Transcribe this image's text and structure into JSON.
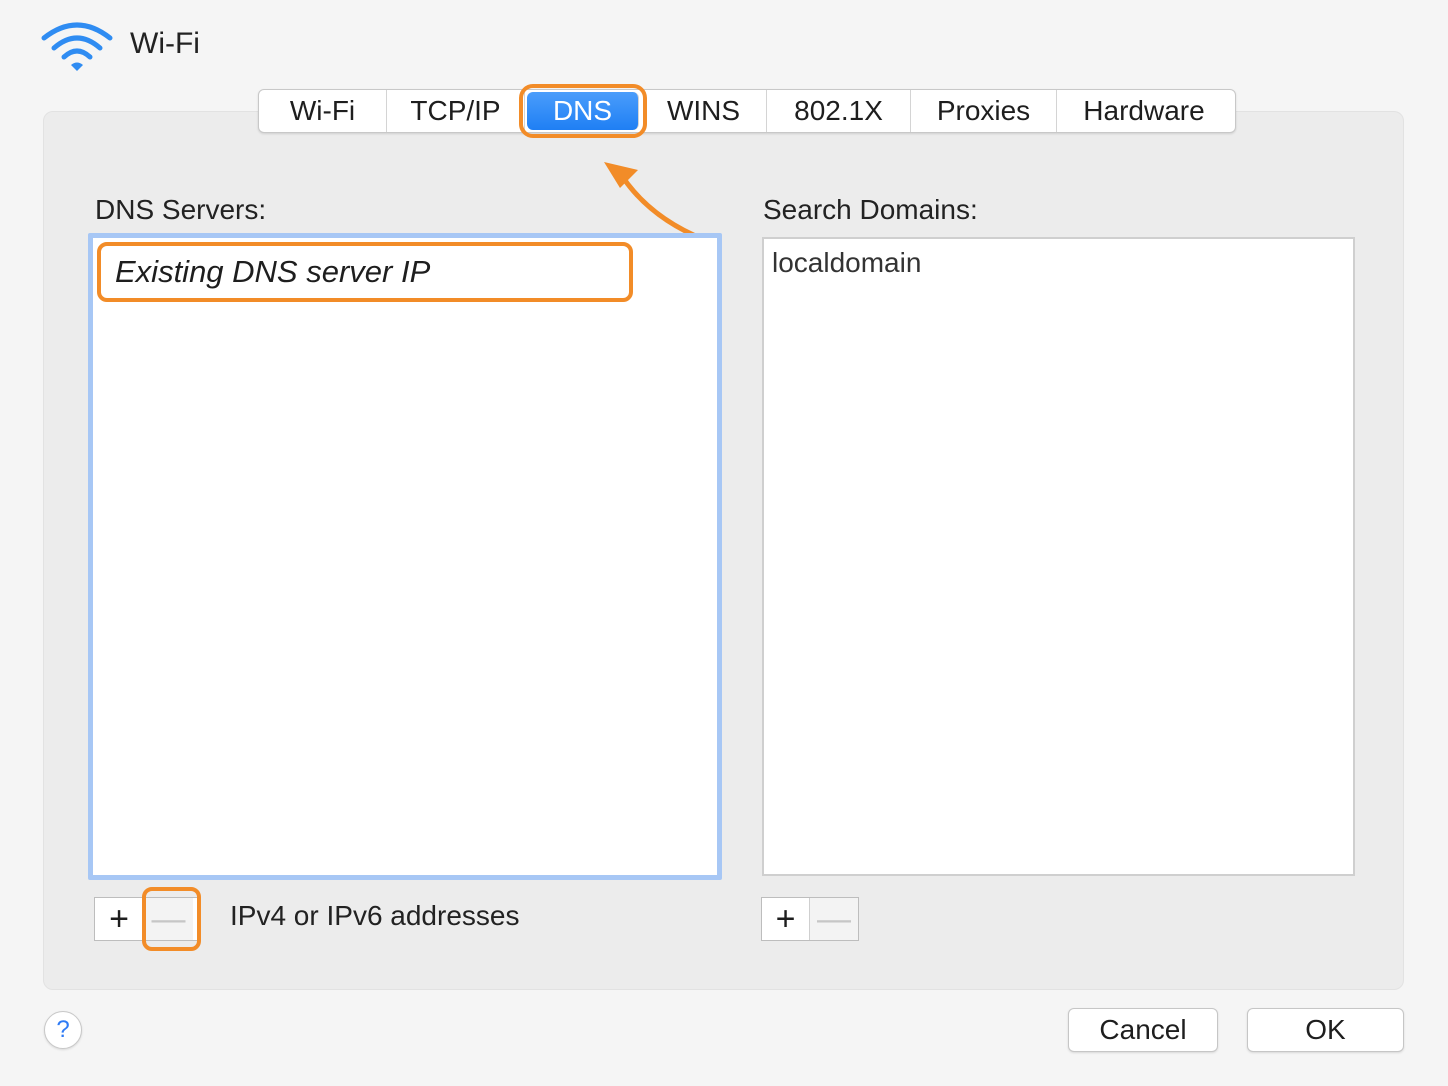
{
  "window": {
    "title": "Wi-Fi",
    "icon": "wifi-icon"
  },
  "tabs": [
    {
      "label": "Wi-Fi",
      "active": false
    },
    {
      "label": "TCP/IP",
      "active": false
    },
    {
      "label": "DNS",
      "active": true
    },
    {
      "label": "WINS",
      "active": false
    },
    {
      "label": "802.1X",
      "active": false
    },
    {
      "label": "Proxies",
      "active": false
    },
    {
      "label": "Hardware",
      "active": false
    }
  ],
  "dns_servers": {
    "label": "DNS Servers:",
    "entries": [
      "Existing DNS server IP"
    ],
    "hint": "IPv4 or IPv6 addresses",
    "add_label": "+",
    "remove_label": "—"
  },
  "search_domains": {
    "label": "Search Domains:",
    "entries": [
      "localdomain"
    ],
    "add_label": "+",
    "remove_label": "—"
  },
  "footer": {
    "help_label": "?",
    "cancel_label": "Cancel",
    "ok_label": "OK"
  },
  "colors": {
    "accent": "#1f7ff4",
    "highlight": "#f28c28",
    "focus_ring": "#a7c7f5"
  }
}
